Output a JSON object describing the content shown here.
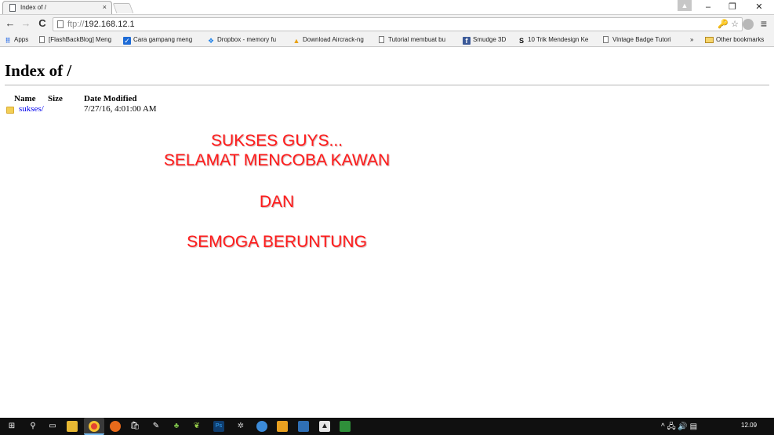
{
  "tab": {
    "title": "Index of /",
    "close": "×"
  },
  "window": {
    "profile": "▲",
    "minimize": "–",
    "restore": "❐",
    "close": "✕"
  },
  "toolbar": {
    "back": "←",
    "forward": "→",
    "reload": "C",
    "url_scheme": "ftp://",
    "url_host": "192.168.12.1",
    "omni_right": "🔑 ☆",
    "menu": "≡"
  },
  "bookmarks": [
    {
      "label": "Apps",
      "icon": "apps-icon"
    },
    {
      "label": "[FlashBackBlog] Meng",
      "icon": "page-icon"
    },
    {
      "label": "Cara gampang meng",
      "icon": "check-icon"
    },
    {
      "label": "Dropbox - memory fu",
      "icon": "dropbox-icon"
    },
    {
      "label": "Download Aircrack-ng",
      "icon": "aircrack-icon"
    },
    {
      "label": "Tutorial membuat bu",
      "icon": "page-icon"
    },
    {
      "label": "Smudge 3D",
      "icon": "facebook-icon"
    },
    {
      "label": "10 Trik Mendesign Ke",
      "icon": "s-icon"
    },
    {
      "label": "Vintage Badge Tutori",
      "icon": "page-icon"
    }
  ],
  "bookmarks_more": "»",
  "bookmarks_other": "Other bookmarks",
  "page": {
    "title": "Index of /",
    "headers": {
      "name": "Name",
      "size": "Size",
      "date": "Date Modified"
    },
    "rows": [
      {
        "name": "sukses/",
        "size": "",
        "date": "7/27/16, 4:01:00 AM"
      }
    ],
    "messages": [
      "SUKSES GUYS...",
      "SELAMAT MENCOBA KAWAN",
      "DAN",
      "SEMOGA BERUNTUNG"
    ]
  },
  "taskbar": {
    "tray": "^ 🖧 🔊 ▤",
    "clock": "12.09"
  },
  "colors": {
    "message": "#ff1a1a",
    "link": "#0000ee",
    "taskbar": "#101010"
  }
}
